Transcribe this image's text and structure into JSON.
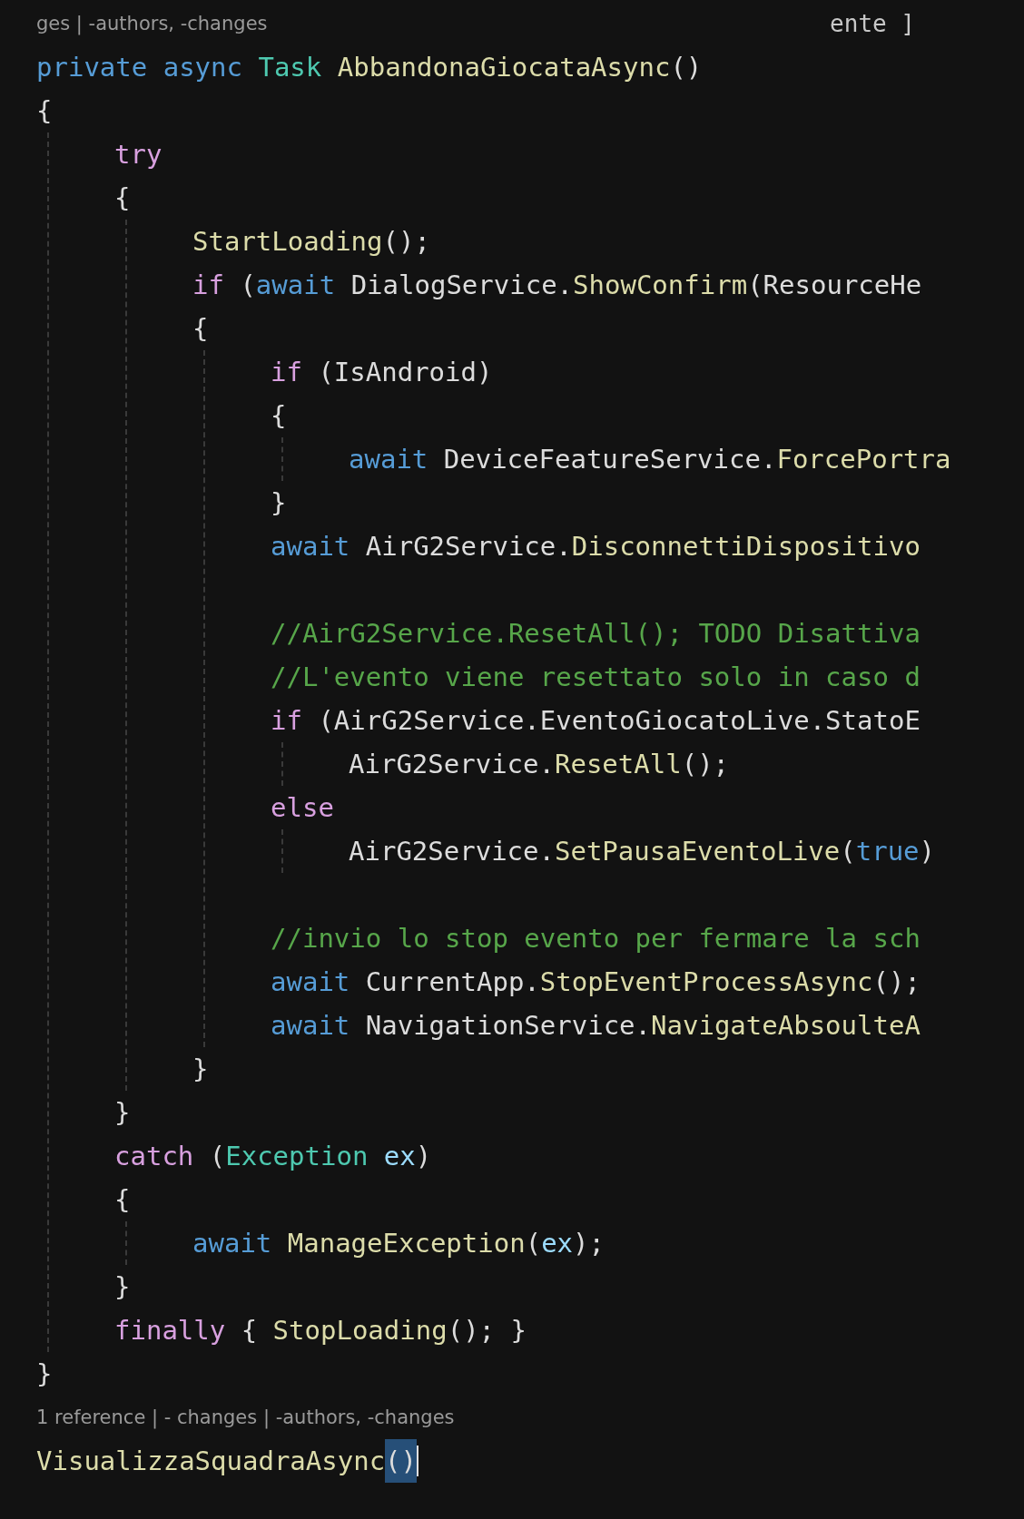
{
  "editor": {
    "lines": [
      {
        "kind": "codelens",
        "tokens": [
          {
            "kind": "lens",
            "text": "ges | -authors, -changes"
          }
        ],
        "aside": "ente ]"
      },
      {
        "kind": "code",
        "tokens": [
          {
            "kind": "kw",
            "text": "private async "
          },
          {
            "kind": "type",
            "text": "Task "
          },
          {
            "kind": "method",
            "text": "AbbandonaGiocataAsync"
          },
          {
            "kind": "plain",
            "text": "()"
          }
        ]
      },
      {
        "kind": "code",
        "tokens": [
          {
            "kind": "plain",
            "text": "{"
          }
        ],
        "children": [
          {
            "kind": "code",
            "tokens": [
              {
                "kind": "ctrl",
                "text": "try"
              }
            ]
          },
          {
            "kind": "code",
            "tokens": [
              {
                "kind": "plain",
                "text": "{"
              }
            ],
            "children": [
              {
                "kind": "code",
                "tokens": [
                  {
                    "kind": "method",
                    "text": "StartLoading"
                  },
                  {
                    "kind": "plain",
                    "text": "();"
                  }
                ]
              },
              {
                "kind": "code",
                "tokens": [
                  {
                    "kind": "ctrl",
                    "text": "if "
                  },
                  {
                    "kind": "plain",
                    "text": "("
                  },
                  {
                    "kind": "kw",
                    "text": "await "
                  },
                  {
                    "kind": "plain",
                    "text": "DialogService."
                  },
                  {
                    "kind": "method",
                    "text": "ShowConfirm"
                  },
                  {
                    "kind": "plain",
                    "text": "(ResourceHe"
                  }
                ]
              },
              {
                "kind": "code",
                "tokens": [
                  {
                    "kind": "plain",
                    "text": "{"
                  }
                ],
                "children": [
                  {
                    "kind": "code",
                    "tokens": [
                      {
                        "kind": "ctrl",
                        "text": "if "
                      },
                      {
                        "kind": "plain",
                        "text": "(IsAndroid)"
                      }
                    ]
                  },
                  {
                    "kind": "code",
                    "tokens": [
                      {
                        "kind": "plain",
                        "text": "{"
                      }
                    ],
                    "children": [
                      {
                        "kind": "code",
                        "tokens": [
                          {
                            "kind": "kw",
                            "text": "await "
                          },
                          {
                            "kind": "plain",
                            "text": "DeviceFeatureService."
                          },
                          {
                            "kind": "method",
                            "text": "ForcePortra"
                          }
                        ]
                      }
                    ]
                  },
                  {
                    "kind": "code",
                    "tokens": [
                      {
                        "kind": "plain",
                        "text": "}"
                      }
                    ]
                  },
                  {
                    "kind": "code",
                    "tokens": [
                      {
                        "kind": "kw",
                        "text": "await "
                      },
                      {
                        "kind": "plain",
                        "text": "AirG2Service."
                      },
                      {
                        "kind": "method",
                        "text": "DisconnettiDispositivo"
                      }
                    ]
                  },
                  {
                    "kind": "blank"
                  },
                  {
                    "kind": "code",
                    "tokens": [
                      {
                        "kind": "comment",
                        "text": "//AirG2Service.ResetAll(); TODO Disattiva"
                      }
                    ]
                  },
                  {
                    "kind": "code",
                    "tokens": [
                      {
                        "kind": "comment",
                        "text": "//L'evento viene resettato solo in caso d"
                      }
                    ]
                  },
                  {
                    "kind": "code",
                    "tokens": [
                      {
                        "kind": "ctrl",
                        "text": "if "
                      },
                      {
                        "kind": "plain",
                        "text": "(AirG2Service.EventoGiocatoLive.StatoE"
                      }
                    ],
                    "children": [
                      {
                        "kind": "code",
                        "tokens": [
                          {
                            "kind": "plain",
                            "text": "AirG2Service."
                          },
                          {
                            "kind": "method",
                            "text": "ResetAll"
                          },
                          {
                            "kind": "plain",
                            "text": "();"
                          }
                        ]
                      }
                    ]
                  },
                  {
                    "kind": "code",
                    "tokens": [
                      {
                        "kind": "ctrl",
                        "text": "else"
                      }
                    ],
                    "children": [
                      {
                        "kind": "code",
                        "tokens": [
                          {
                            "kind": "plain",
                            "text": "AirG2Service."
                          },
                          {
                            "kind": "method",
                            "text": "SetPausaEventoLive"
                          },
                          {
                            "kind": "plain",
                            "text": "("
                          },
                          {
                            "kind": "kw",
                            "text": "true"
                          },
                          {
                            "kind": "plain",
                            "text": ")"
                          }
                        ]
                      }
                    ]
                  },
                  {
                    "kind": "blank"
                  },
                  {
                    "kind": "code",
                    "tokens": [
                      {
                        "kind": "comment",
                        "text": "//invio lo stop evento per fermare la sch"
                      }
                    ]
                  },
                  {
                    "kind": "code",
                    "tokens": [
                      {
                        "kind": "kw",
                        "text": "await "
                      },
                      {
                        "kind": "plain",
                        "text": "CurrentApp."
                      },
                      {
                        "kind": "method",
                        "text": "StopEventProcessAsync"
                      },
                      {
                        "kind": "plain",
                        "text": "();"
                      }
                    ]
                  },
                  {
                    "kind": "code",
                    "tokens": [
                      {
                        "kind": "kw",
                        "text": "await "
                      },
                      {
                        "kind": "plain",
                        "text": "NavigationService."
                      },
                      {
                        "kind": "method",
                        "text": "NavigateAbsoulteA"
                      }
                    ]
                  }
                ]
              },
              {
                "kind": "code",
                "tokens": [
                  {
                    "kind": "plain",
                    "text": "}"
                  }
                ]
              }
            ]
          },
          {
            "kind": "code",
            "tokens": [
              {
                "kind": "plain",
                "text": "}"
              }
            ]
          },
          {
            "kind": "code",
            "tokens": [
              {
                "kind": "ctrl",
                "text": "catch "
              },
              {
                "kind": "plain",
                "text": "("
              },
              {
                "kind": "type",
                "text": "Exception "
              },
              {
                "kind": "param",
                "text": "ex"
              },
              {
                "kind": "plain",
                "text": ")"
              }
            ]
          },
          {
            "kind": "code",
            "tokens": [
              {
                "kind": "plain",
                "text": "{"
              }
            ],
            "children": [
              {
                "kind": "code",
                "tokens": [
                  {
                    "kind": "kw",
                    "text": "await "
                  },
                  {
                    "kind": "method",
                    "text": "ManageException"
                  },
                  {
                    "kind": "plain",
                    "text": "("
                  },
                  {
                    "kind": "param",
                    "text": "ex"
                  },
                  {
                    "kind": "plain",
                    "text": ");"
                  }
                ]
              }
            ]
          },
          {
            "kind": "code",
            "tokens": [
              {
                "kind": "plain",
                "text": "}"
              }
            ]
          },
          {
            "kind": "code",
            "tokens": [
              {
                "kind": "ctrl",
                "text": "finally "
              },
              {
                "kind": "plain",
                "text": "{ "
              },
              {
                "kind": "method",
                "text": "StopLoading"
              },
              {
                "kind": "plain",
                "text": "(); }"
              }
            ]
          }
        ]
      },
      {
        "kind": "code",
        "tokens": [
          {
            "kind": "plain",
            "text": "}"
          }
        ]
      },
      {
        "kind": "codelens",
        "tokens": [
          {
            "kind": "lens",
            "text": "1 reference | - changes | -authors, -changes"
          }
        ]
      },
      {
        "kind": "code",
        "cursor": true,
        "tokens": [
          {
            "kind": "method",
            "text": "VisualizzaSquadraAsync"
          },
          {
            "kind": "selected",
            "text": "()"
          }
        ]
      }
    ]
  }
}
